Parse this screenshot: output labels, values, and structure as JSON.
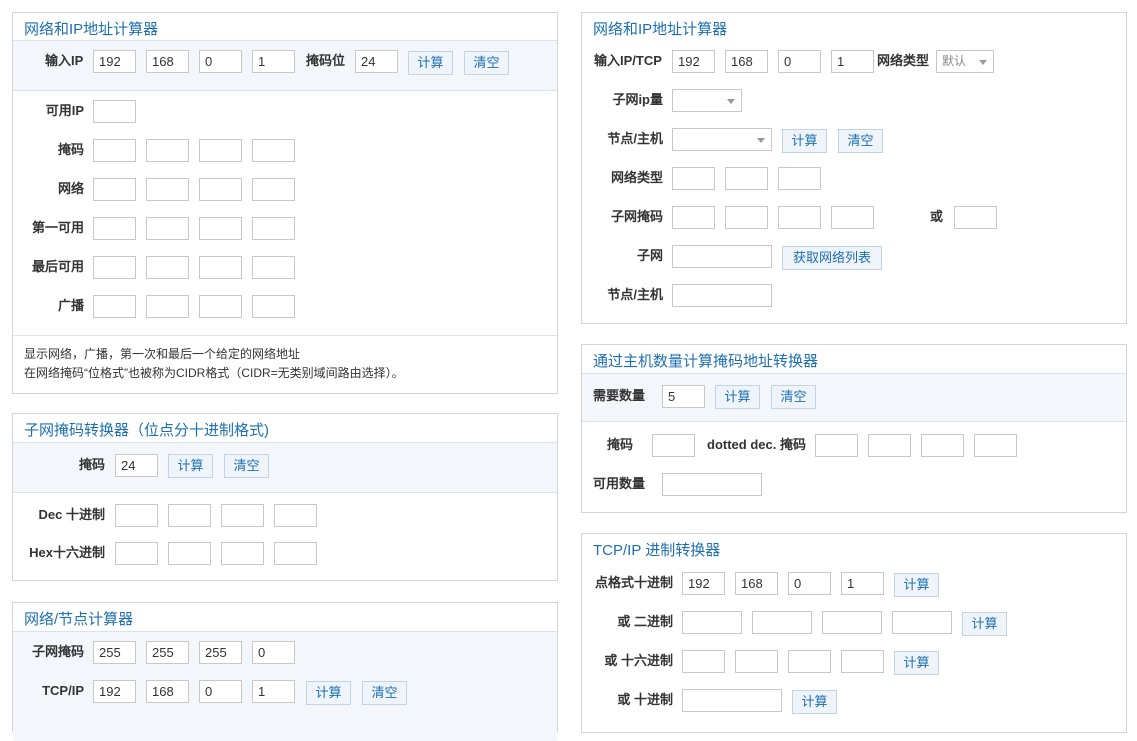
{
  "ip_calc": {
    "title": "网络和IP地址计算器",
    "input_label": "输入IP",
    "ip": [
      "192",
      "168",
      "0",
      "1"
    ],
    "mask_bits_label": "掩码位",
    "mask_bits": "24",
    "calc": "计算",
    "clear": "清空",
    "available_ip_label": "可用IP",
    "mask_label": "掩码",
    "network_label": "网络",
    "first_label": "第一可用",
    "last_label": "最后可用",
    "broadcast_label": "广播",
    "note1": "显示网络，广播，第一次和最后一个给定的网络地址",
    "note2": "在网络掩码“位格式”也被称为CIDR格式（CIDR=无类别域间路由选择）。"
  },
  "mask_conv": {
    "title": "子网掩码转换器（位点分十进制格式)",
    "mask_label": "掩码",
    "mask": "24",
    "calc": "计算",
    "clear": "清空",
    "dec_label": "Dec 十进制",
    "hex_label": "Hex十六进制"
  },
  "node_calc": {
    "title": "网络/节点计算器",
    "subnet_label": "子网掩码",
    "subnet": [
      "255",
      "255",
      "255",
      "0"
    ],
    "tcpip_label": "TCP/IP",
    "tcpip": [
      "192",
      "168",
      "0",
      "1"
    ],
    "calc": "计算",
    "clear": "清空"
  },
  "ip_tcp": {
    "title": "网络和IP地址计算器",
    "input_label": "输入IP/TCP",
    "ip": [
      "192",
      "168",
      "0",
      "1"
    ],
    "nettype_label": "网络类型",
    "nettype_value": "默认",
    "subnet_ip_label": "子网ip量",
    "node_label": "节点/主机",
    "calc": "计算",
    "clear": "清空",
    "net_type_label": "网络类型",
    "subnet_mask_label": "子网掩码",
    "or": "或",
    "subnet_label": "子网",
    "get_list": "获取网络列表",
    "node2_label": "节点/主机"
  },
  "host_count": {
    "title": "通过主机数量计算掩码地址转换器",
    "need_label": "需要数量",
    "need": "5",
    "calc": "计算",
    "clear": "清空",
    "mask_label": "掩码",
    "dotted_label": "dotted dec. 掩码",
    "available_label": "可用数量"
  },
  "tcp_conv": {
    "title": "TCP/IP 进制转换器",
    "dotted_label": "点格式十进制",
    "dotted": [
      "192",
      "168",
      "0",
      "1"
    ],
    "calc": "计算",
    "binary_label": "或 二进制",
    "hex_label": "或 十六进制",
    "decimal_label": "或 十进制"
  }
}
